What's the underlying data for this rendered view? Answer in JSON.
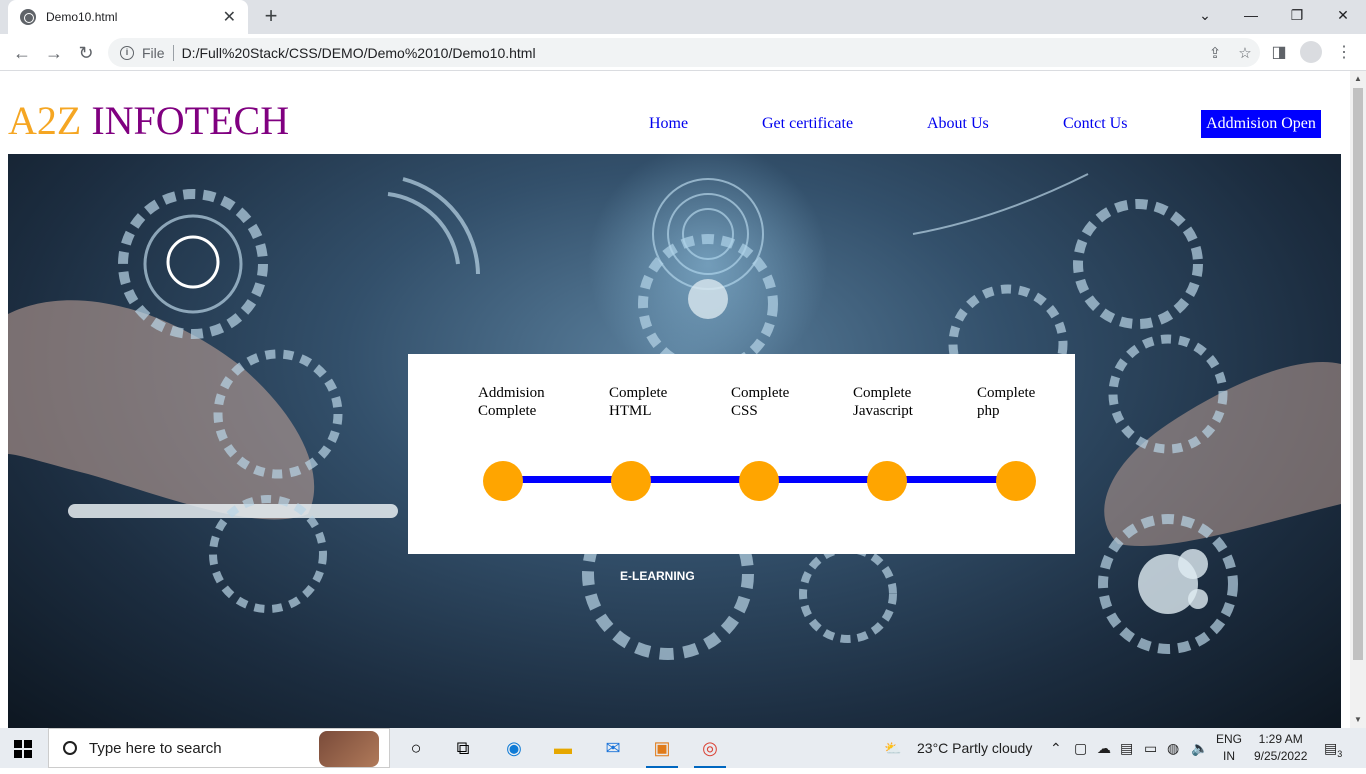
{
  "browser": {
    "tab_title": "Demo10.html",
    "omnibox_file": "File",
    "url": "D:/Full%20Stack/CSS/DEMO/Demo%2010/Demo10.html"
  },
  "site": {
    "logo_a": "A2Z",
    "logo_b": " INFOTECH",
    "nav": [
      "Home",
      "Get certificate",
      "About Us",
      "Contct Us",
      "Addmision Open"
    ]
  },
  "progress": {
    "steps": [
      {
        "line1": "Addmision",
        "line2": "Complete"
      },
      {
        "line1": "Complete",
        "line2": "HTML"
      },
      {
        "line1": "Complete",
        "line2": "CSS"
      },
      {
        "line1": "Complete",
        "line2": "Javascript"
      },
      {
        "line1": "Complete",
        "line2": "php"
      }
    ],
    "dot_color": "#ffa500",
    "line_color": "#0000ff"
  },
  "hero": {
    "caption": "E-LEARNING"
  },
  "taskbar": {
    "search_placeholder": "Type here to search",
    "weather": "23°C  Partly cloudy",
    "lang1": "ENG",
    "lang2": "IN",
    "time": "1:29 AM",
    "date": "9/25/2022",
    "notification_count": "3"
  }
}
